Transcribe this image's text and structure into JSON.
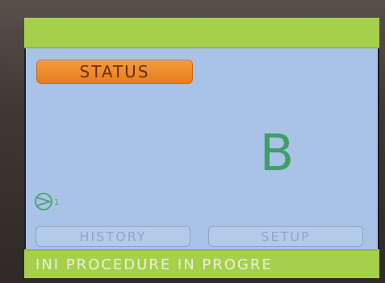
{
  "status_button": {
    "label": "STATUS"
  },
  "main": {
    "big_letter": "B"
  },
  "pump_indicator": {
    "icon": "pump-icon",
    "subscript": "1"
  },
  "bottom_buttons": {
    "history_label": "HISTORY",
    "setup_label": "SETUP"
  },
  "footer": {
    "message": "INI PROCEDURE IN PROGRE"
  },
  "colors": {
    "screen_background": "#a9c3e7",
    "top_bar": "#a6cf4c",
    "status_button": "#e77f1b",
    "big_letter": "#3f9f66",
    "button_outline": "#8aa2c7",
    "footer_text": "#e9f2d6"
  }
}
